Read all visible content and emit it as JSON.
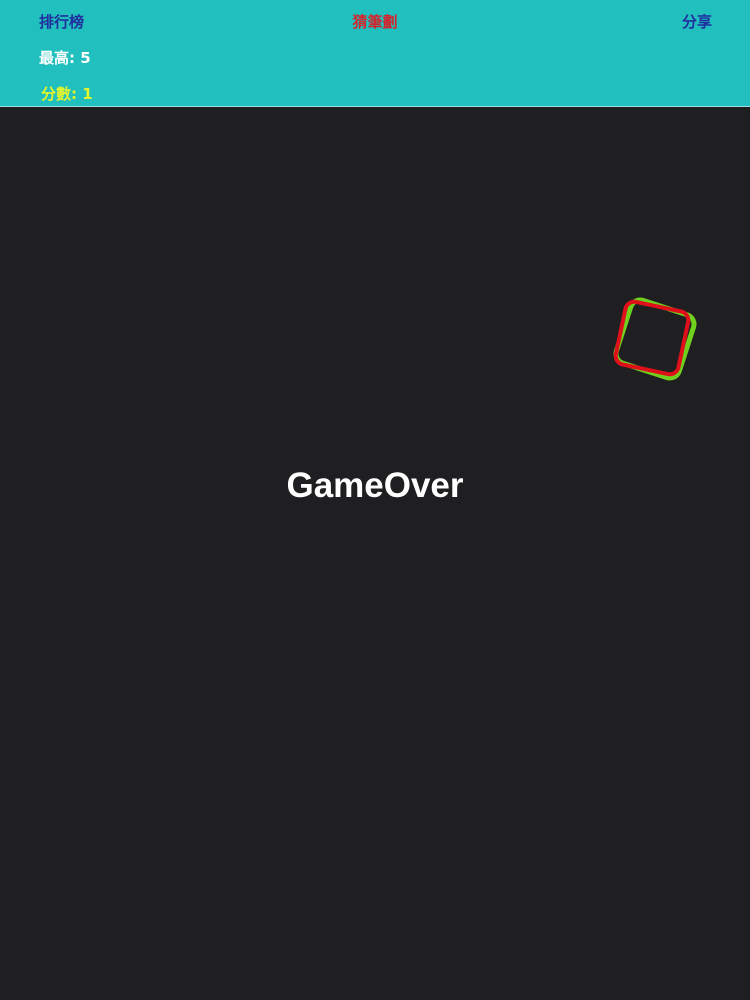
{
  "header": {
    "leaderboard_label": "排行榜",
    "title": "猜筆劃",
    "share_label": "分享",
    "best_label": "最高: 5",
    "score_label": "分數: 1"
  },
  "game": {
    "status_text": "GameOver"
  },
  "colors": {
    "header_bg": "#21bfbd",
    "play_bg": "#1f1e20",
    "target_shape": "#6fd11e",
    "drawn_shape": "#e0101a",
    "score": "#e5f52b",
    "nav_link": "#1f2f9f",
    "title": "#d1262d"
  }
}
